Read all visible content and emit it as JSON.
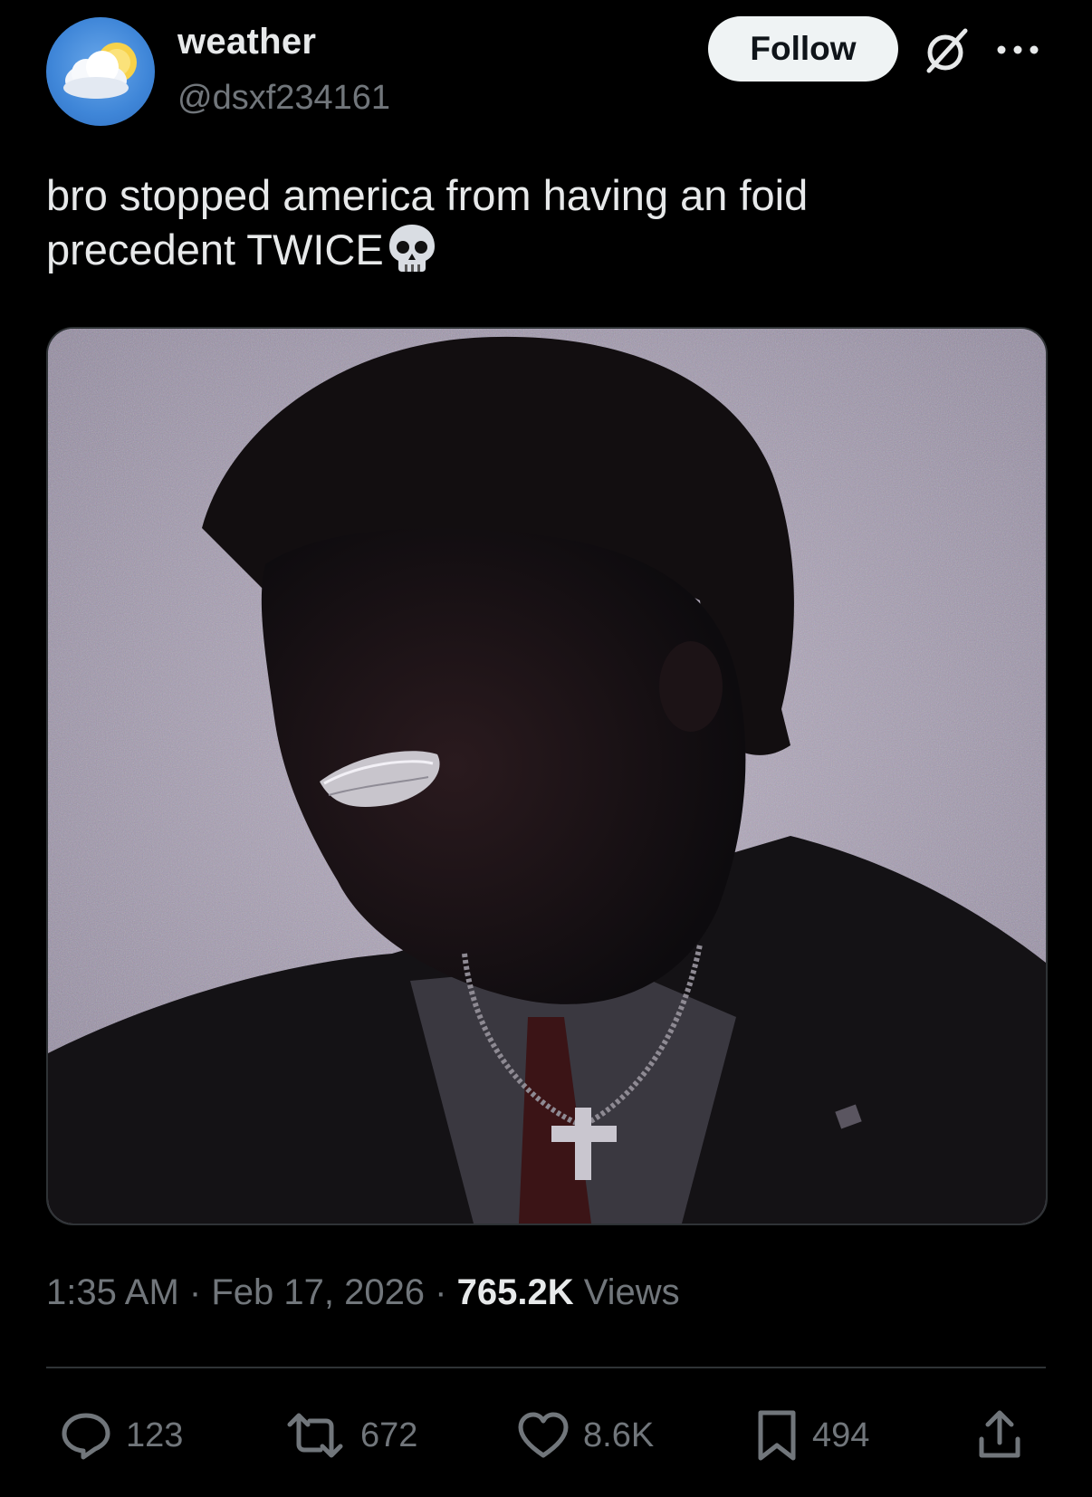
{
  "author": {
    "display_name": "weather",
    "handle": "@dsxf234161",
    "avatar_icon": "cloud-sun-icon"
  },
  "header": {
    "follow_label": "Follow",
    "grok_icon": "grok-icon",
    "more_icon": "more-icon"
  },
  "tweet": {
    "text_line1": "bro stopped america from having an foid",
    "text_line2": "precedent TWICE",
    "emoji": "skull-icon"
  },
  "media": {
    "description_icon": "photo"
  },
  "meta": {
    "time": "1:35 AM",
    "separator": " · ",
    "date": "Feb 17, 2026",
    "views_count": "765.2K",
    "views_label": " Views"
  },
  "actions": {
    "reply_count": "123",
    "repost_count": "672",
    "like_count": "8.6K",
    "bookmark_count": "494",
    "share_icon": "share-icon"
  },
  "colors": {
    "background": "#000000",
    "text_primary": "#e7e9ea",
    "text_secondary": "#71767b",
    "follow_bg": "#eff3f4",
    "divider": "#2f3336"
  }
}
